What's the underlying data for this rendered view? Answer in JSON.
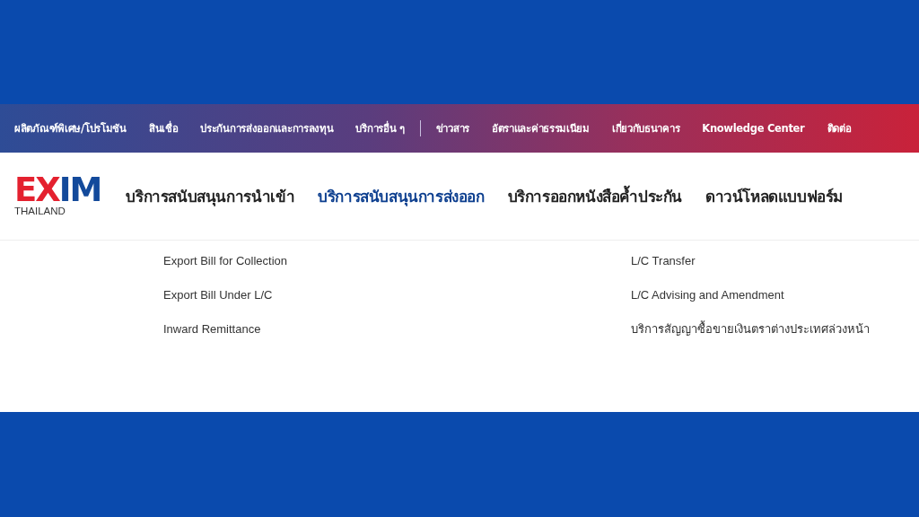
{
  "top_nav": [
    {
      "label": "ผลิตภัณฑ์พิเศษ/โปรโมชัน"
    },
    {
      "label": "สินเชื่อ"
    },
    {
      "label": "ประกันการส่งออกและการลงทุน"
    },
    {
      "label": "บริการอื่น ๆ"
    },
    {
      "label": "ข่าวสาร"
    },
    {
      "label": "อัตราและค่าธรรมเนียม"
    },
    {
      "label": "เกี่ยวกับธนาคาร"
    },
    {
      "label": "Knowledge Center"
    },
    {
      "label": "ติดต่อ"
    }
  ],
  "logo": {
    "mark_left": "EX",
    "mark_right": "IM",
    "subtitle": "THAILAND"
  },
  "main_nav": [
    {
      "label": "บริการสนับสนุนการนำเข้า",
      "selected": false
    },
    {
      "label": "บริการสนับสนุนการส่งออก",
      "selected": true
    },
    {
      "label": "บริการออกหนังสือค้ำประกัน",
      "selected": false
    },
    {
      "label": "ดาวน์โหลดแบบฟอร์ม",
      "selected": false
    }
  ],
  "dropdown": {
    "column_1": [
      "Export Bill for Collection",
      "Export Bill Under L/C",
      "Inward Remittance"
    ],
    "column_2": [
      "L/C Transfer",
      "L/C Advising and Amendment",
      "บริการสัญญาซื้อขายเงินตราต่างประเทศล่วงหน้า"
    ]
  }
}
